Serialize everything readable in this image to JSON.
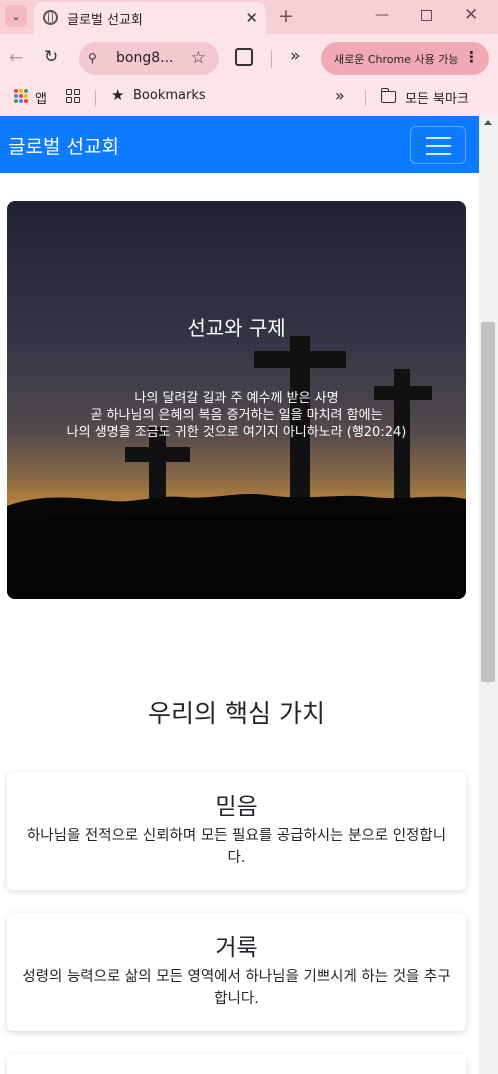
{
  "browser": {
    "tab_title": "글로벌 선교회",
    "url": "bong8...",
    "chrome_promo": "새로운 Chrome 사용 가능",
    "bookmarks": {
      "apps_label": "앱",
      "bookmarks_label": "Bookmarks",
      "all_bookmarks_label": "모든 북마크"
    }
  },
  "navbar": {
    "brand": "글로벌 선교회"
  },
  "hero": {
    "title": "선교와 구제",
    "lines": [
      "나의 달려갈 길과 주 예수께 받은 사명",
      "곧 하나님의 은혜의 복음 증거하는 일을 마치려 함에는",
      "나의 생명을 조금도 귀한 것으로 여기지 아니하노라 (행20:24)"
    ]
  },
  "values": {
    "heading": "우리의 핵심 가치",
    "cards": [
      {
        "title": "믿음",
        "text": "하나님을 전적으로 신뢰하며 모든 필요를 공급하시는 분으로 인정합니다."
      },
      {
        "title": "거룩",
        "text": "성령의 능력으로 삶의 모든 영역에서 하나님을 기쁘시게 하는 것을 추구합니다."
      }
    ]
  },
  "colors": {
    "navbar": "#0d7bff",
    "chrome_frame": "#f9cfd6"
  }
}
